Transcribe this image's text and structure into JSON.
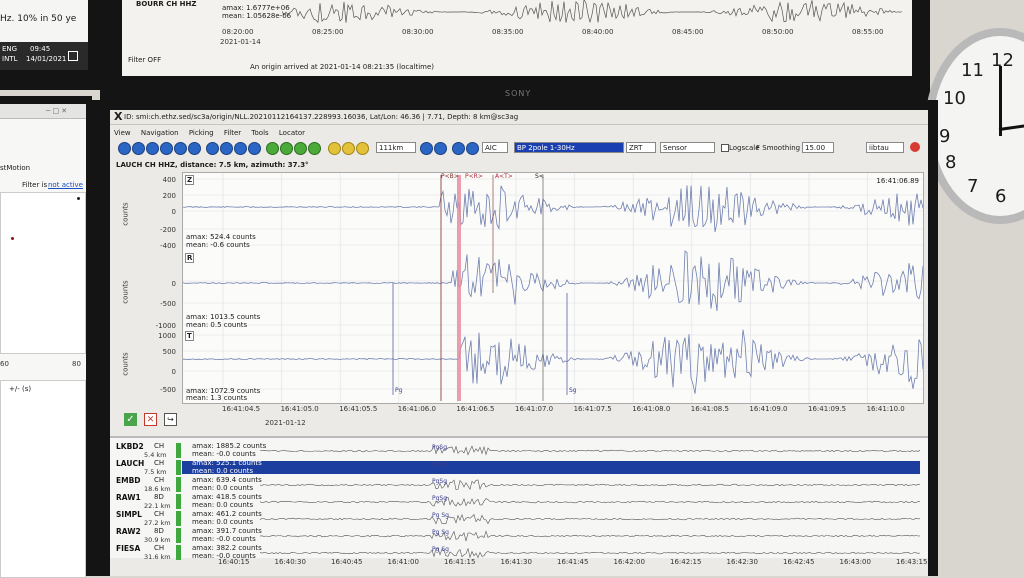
{
  "top_monitor": {
    "trace_amax": "amax: 1.6777e+06",
    "trace_mean": "mean: 1.05628e-06",
    "station": "BOURR CH HHZ",
    "time_ticks": [
      "08:20:00",
      "08:25:00",
      "08:30:00",
      "08:35:00",
      "08:40:00",
      "08:45:00",
      "08:50:00",
      "08:55:00"
    ],
    "date": "2021-01-14",
    "filter_status": "Filter OFF",
    "status_message": "An origin arrived at 2021-01-14 08:21:35 (localtime)",
    "brand": "SONY"
  },
  "left_monitor": {
    "text_fragment": "Hz. 10% in 50 ye",
    "lang1": "ENG",
    "time1": "09:45",
    "lang2": "INTL",
    "date1": "14/01/2021",
    "panel_title": "stMotion",
    "filter_label": "Filter is",
    "filter_value": "not active",
    "axis_a": "60",
    "axis_b": "80",
    "col_header": "+/- (s)"
  },
  "window": {
    "title": "ID: smi:ch.ethz.sed/sc3a/origin/NLL.20210112164137.228993.16036, Lat/Lon: 46.36 | 7.71, Depth: 8 km@sc3ag",
    "menu": [
      "View",
      "Navigation",
      "Picking",
      "Filter",
      "Tools",
      "Locator"
    ],
    "toolbar": {
      "distance": "111km",
      "picker": "AIC",
      "filter": "BP 2pole 1-30Hz",
      "rotation": "ZRT",
      "units": "Sensor",
      "logscale_label": "Logscale",
      "smoothing_label": "F Smoothing",
      "smoothing_value": "15.00",
      "agency": "iibtau"
    }
  },
  "main_trace": {
    "header": "LAUCH CH HHZ, distance: 7.5 km, azimuth: 37.3°",
    "corner_time": "16:41:06.89",
    "ylabel": "counts",
    "components": [
      {
        "name": "Z",
        "ticks": [
          "400",
          "200",
          "0",
          "-200",
          "-400"
        ],
        "amax": "amax: 524.4 counts",
        "mean": "mean: -0.6 counts"
      },
      {
        "name": "R",
        "ticks": [
          "0",
          "-500",
          "-1000"
        ],
        "amax": "amax: 1013.5 counts",
        "mean": "mean: 0.5 counts"
      },
      {
        "name": "T",
        "ticks": [
          "1000",
          "500",
          "0",
          "-500"
        ],
        "amax": "amax: 1072.9 counts",
        "mean": "mean: 1.3 counts"
      }
    ],
    "pick_labels": [
      "P<B>",
      "P<R>",
      "A<T>",
      "S<",
      "Pg",
      "Sg"
    ],
    "time_ticks": [
      "16:41:04.5",
      "16:41:05.0",
      "16:41:05.5",
      "16:41:06.0",
      "16:41:06.5",
      "16:41:07.0",
      "16:41:07.5",
      "16:41:08.0",
      "16:41:08.5",
      "16:41:09.0",
      "16:41:09.5",
      "16:41:10.0"
    ],
    "date": "2021-01-12"
  },
  "station_list": {
    "rows": [
      {
        "name": "LKBD2",
        "net": "CH",
        "dist": "5.4 km",
        "amax": "amax: 1885.2 counts",
        "mean": "mean: -0.0 counts",
        "pick": "PgSg"
      },
      {
        "name": "LAUCH",
        "net": "CH",
        "dist": "7.5 km",
        "amax": "amax: 525.1 counts",
        "mean": "mean: 0.0 counts",
        "pick": "PgSg",
        "selected": true
      },
      {
        "name": "EMBD",
        "net": "CH",
        "dist": "18.6 km",
        "amax": "amax: 639.4 counts",
        "mean": "mean: 0.0 counts",
        "pick": "PgSg"
      },
      {
        "name": "RAW1",
        "net": "8D",
        "dist": "22.1 km",
        "amax": "amax: 418.5 counts",
        "mean": "mean: 0.0 counts",
        "pick": "PgSg"
      },
      {
        "name": "SIMPL",
        "net": "CH",
        "dist": "27.2 km",
        "amax": "amax: 461.2 counts",
        "mean": "mean: 0.0 counts",
        "pick": "Pg Sg"
      },
      {
        "name": "RAW2",
        "net": "8D",
        "dist": "30.9 km",
        "amax": "amax: 391.7 counts",
        "mean": "mean: -0.0 counts",
        "pick": "Pg Sg"
      },
      {
        "name": "FIESA",
        "net": "CH",
        "dist": "31.6 km",
        "amax": "amax: 382.2 counts",
        "mean": "mean: -0.0 counts",
        "pick": "Pg Sg"
      }
    ],
    "time_ticks": [
      "16:40:15",
      "16:40:30",
      "16:40:45",
      "16:41:00",
      "16:41:15",
      "16:41:30",
      "16:41:45",
      "16:42:00",
      "16:42:15",
      "16:42:30",
      "16:42:45",
      "16:43:00",
      "16:43:15"
    ]
  },
  "clock": {
    "numbers": [
      "12",
      "11",
      "10",
      "9",
      "8",
      "7",
      "6"
    ]
  }
}
